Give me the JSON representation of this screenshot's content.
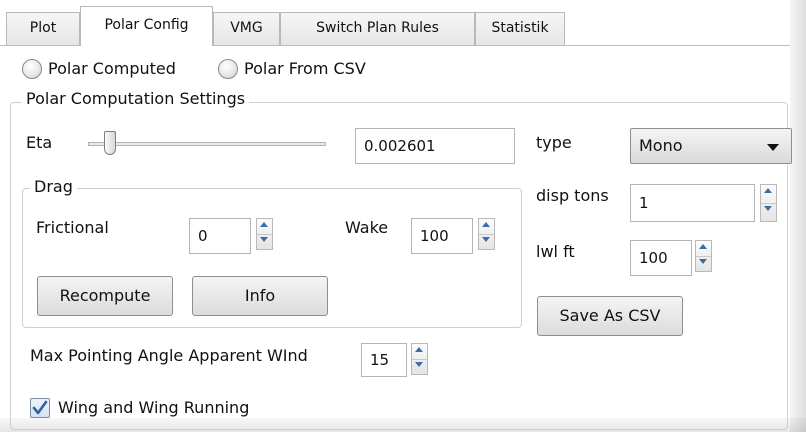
{
  "tabs": [
    {
      "label": "Plot"
    },
    {
      "label": "Polar Config",
      "active": true
    },
    {
      "label": "VMG"
    },
    {
      "label": "Switch Plan Rules"
    },
    {
      "label": "Statistik"
    }
  ],
  "polar_source": {
    "computed_label": "Polar Computed",
    "csv_label": "Polar From CSV"
  },
  "settings_group": {
    "title": "Polar Computation Settings",
    "eta_label": "Eta",
    "eta_value": "0.002601",
    "type_label": "type",
    "type_value": "Mono",
    "disp_tons_label": "disp tons",
    "disp_tons_value": "1",
    "lwl_ft_label": "lwl ft",
    "lwl_ft_value": "100",
    "save_csv_label": "Save As CSV"
  },
  "drag_group": {
    "title": "Drag",
    "frictional_label": "Frictional",
    "frictional_value": "0",
    "wake_label": "Wake",
    "wake_value": "100",
    "recompute_label": "Recompute",
    "info_label": "Info"
  },
  "max_pointing": {
    "label": "Max Pointing Angle Apparent WInd",
    "value": "15"
  },
  "wing_and_wing": {
    "label": "Wing and Wing Running",
    "checked": true
  },
  "colors": {
    "accent": "#3a6ea5",
    "check": "#2f5fa8",
    "border": "#b5b5b5"
  }
}
